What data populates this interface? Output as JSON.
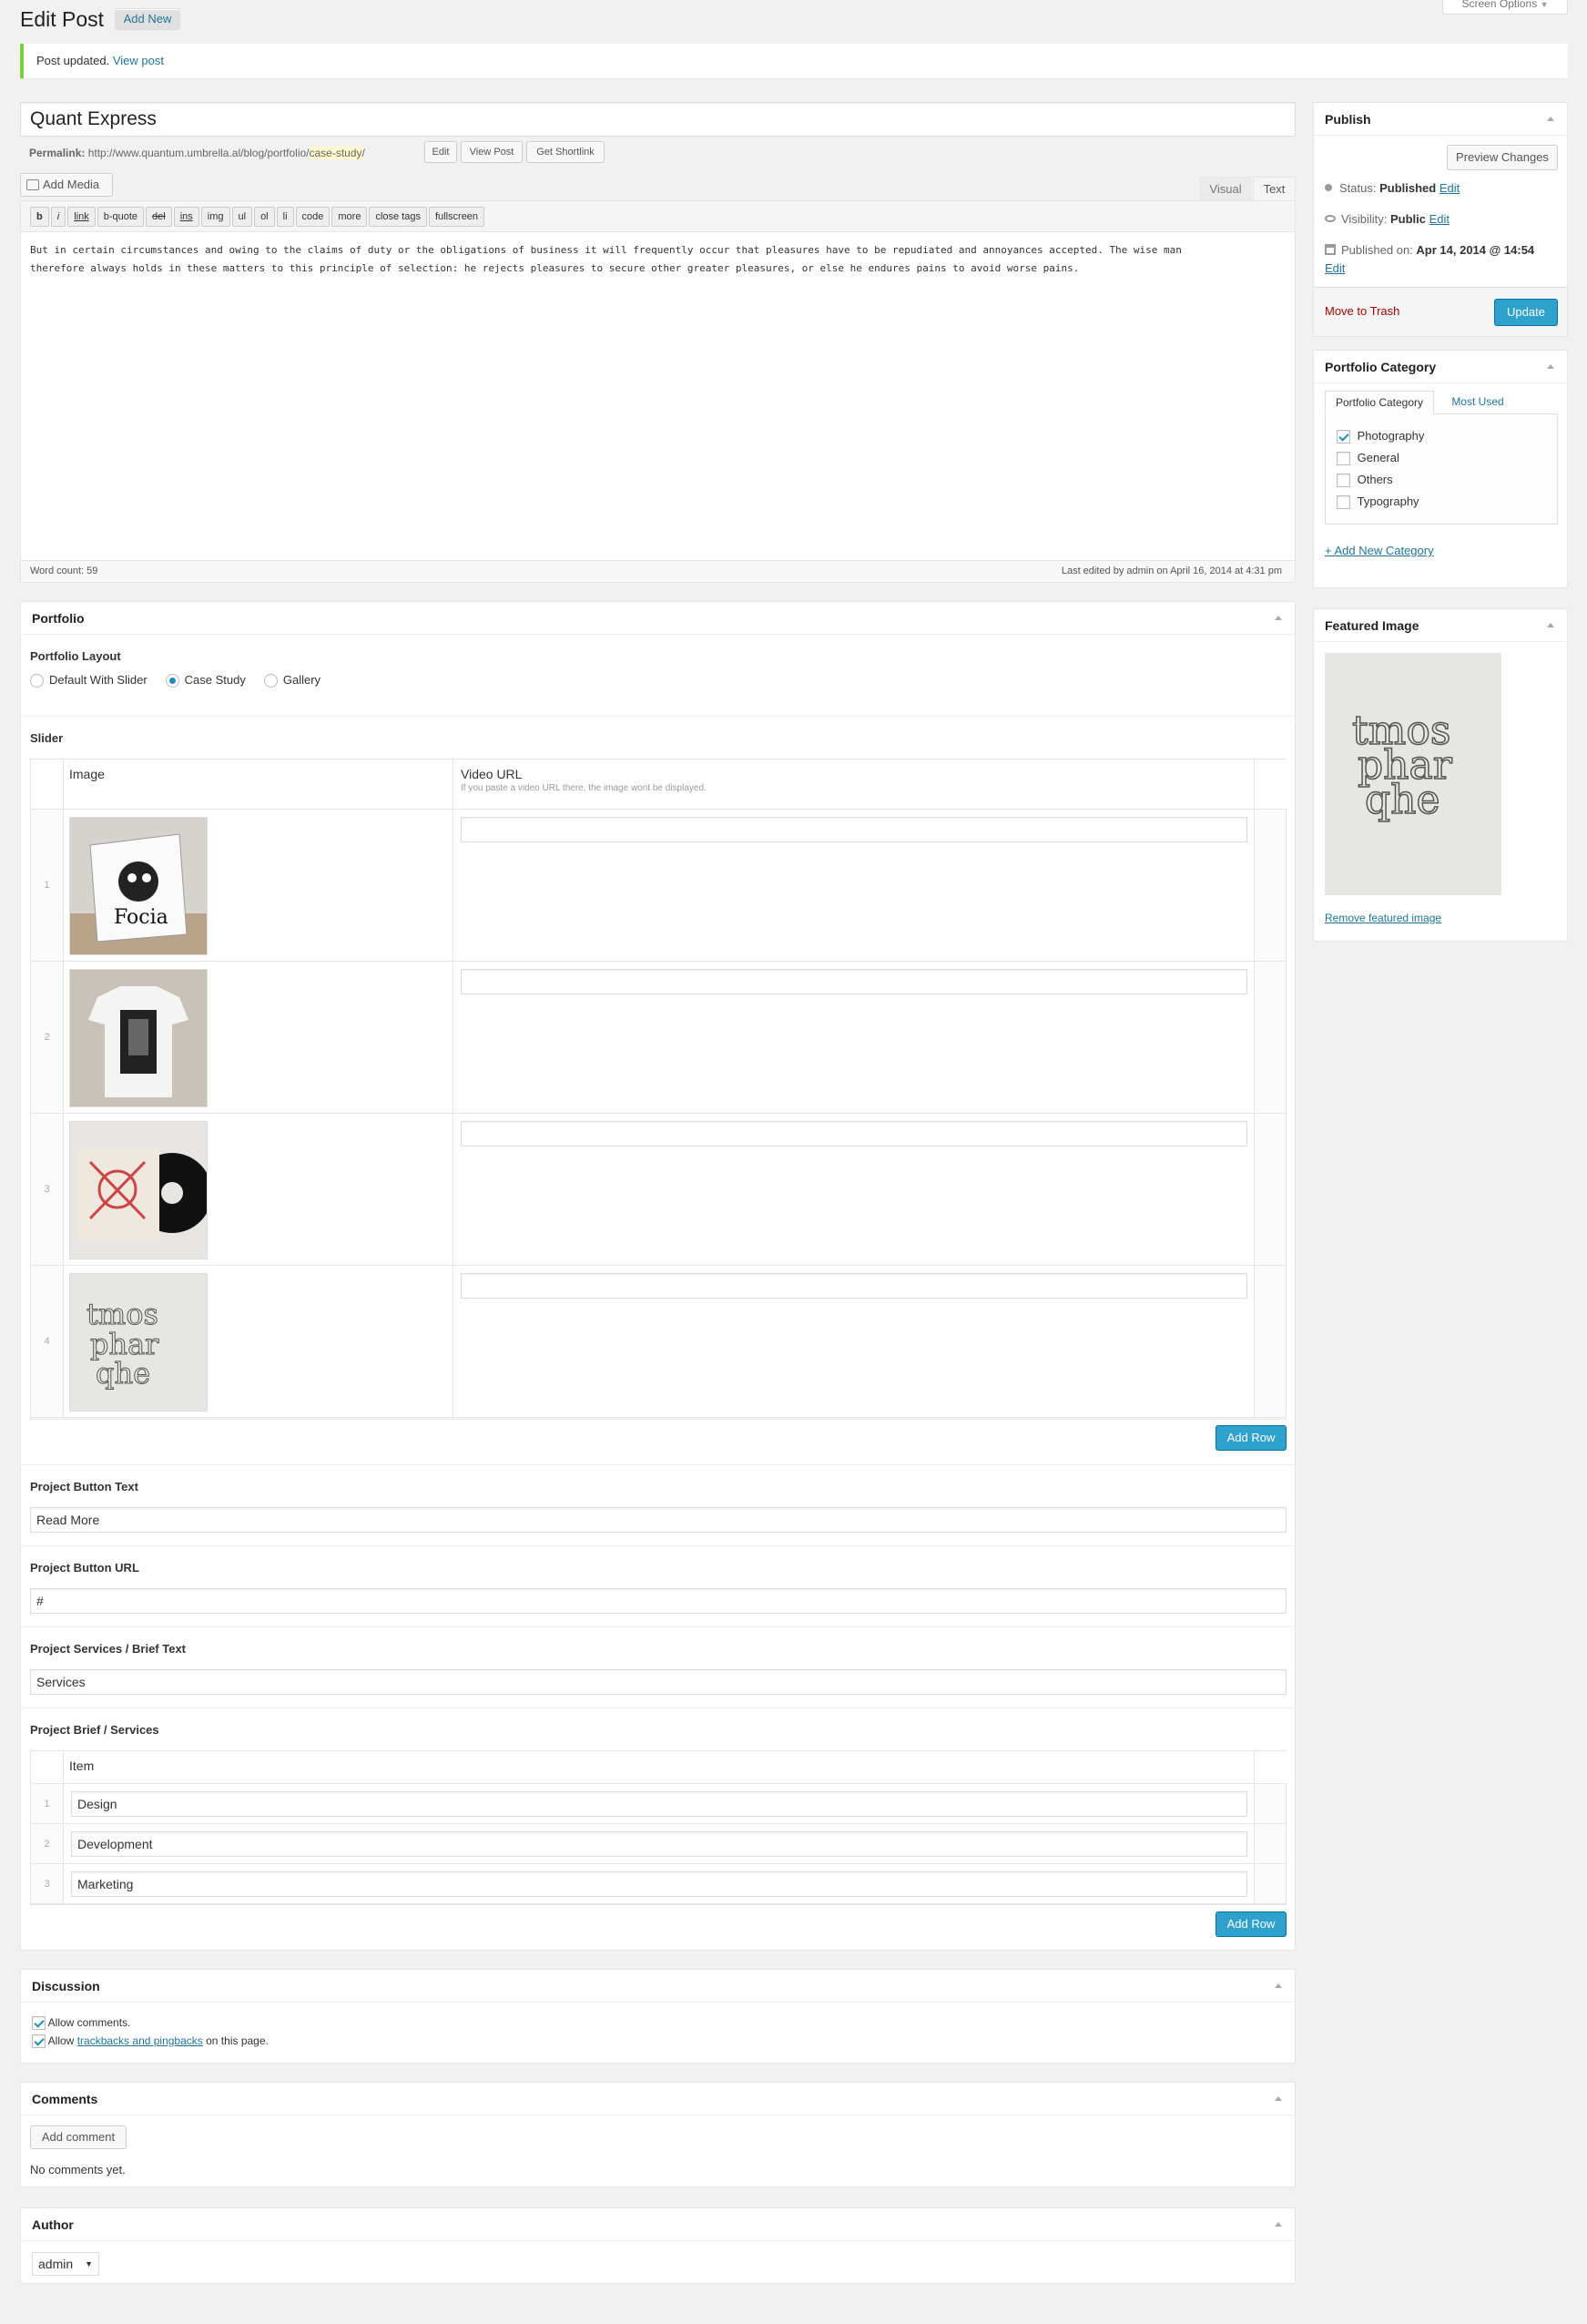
{
  "header": {
    "title": "Edit Post",
    "add_new": "Add New",
    "screen_options": "Screen Options"
  },
  "notice": {
    "text": "Post updated.",
    "link": "View post"
  },
  "post": {
    "title": "Quant Express",
    "permalink_label": "Permalink:",
    "permalink_base": "http://www.quantum.umbrella.al/blog/portfolio/",
    "permalink_slug": "case-study",
    "permalink_end": "/",
    "btn_edit": "Edit",
    "btn_view_post": "View Post",
    "btn_shortlink": "Get Shortlink"
  },
  "editor": {
    "add_media": "Add Media",
    "tab_visual": "Visual",
    "tab_text": "Text",
    "quicktags": [
      "b",
      "i",
      "link",
      "b-quote",
      "del",
      "ins",
      "img",
      "ul",
      "ol",
      "li",
      "code",
      "more",
      "close tags",
      "fullscreen"
    ],
    "content_line1": "But in certain circumstances and owing to the claims of duty or the obligations of business it will frequently occur that pleasures have to be repudiated and annoyances accepted. The wise man",
    "content_line2": "therefore always holds in these matters to this principle of selection: he rejects pleasures to secure other greater pleasures, or else he endures pains to avoid worse pains.",
    "word_count": "Word count: 59",
    "last_edited": "Last edited by admin on April 16, 2014 at 4:31 pm"
  },
  "portfolio": {
    "title": "Portfolio",
    "layout_label": "Portfolio Layout",
    "layout_options": [
      "Default With Slider",
      "Case Study",
      "Gallery"
    ],
    "layout_selected": "Case Study",
    "slider_label": "Slider",
    "col_image": "Image",
    "col_video": "Video URL",
    "col_video_hint": "If you paste a video URL there, the image wont be displayed.",
    "rows": [
      {
        "num": "1",
        "video": ""
      },
      {
        "num": "2",
        "video": ""
      },
      {
        "num": "3",
        "video": ""
      },
      {
        "num": "4",
        "video": ""
      }
    ],
    "add_row": "Add Row",
    "button_text_label": "Project Button Text",
    "button_text_value": "Read More",
    "button_url_label": "Project Button URL",
    "button_url_value": "#",
    "services_label": "Project Services / Brief Text",
    "services_value": "Services",
    "brief_label": "Project Brief / Services",
    "brief_col": "Item",
    "brief_items": [
      {
        "num": "1",
        "value": "Design"
      },
      {
        "num": "2",
        "value": "Development"
      },
      {
        "num": "3",
        "value": "Marketing"
      }
    ],
    "add_row_2": "Add Row"
  },
  "discussion": {
    "title": "Discussion",
    "allow_comments": "Allow comments.",
    "allow_pre": "Allow",
    "allow_link": "trackbacks and pingbacks",
    "allow_post": "on this page."
  },
  "comments": {
    "title": "Comments",
    "add_comment": "Add comment",
    "none": "No comments yet."
  },
  "author": {
    "title": "Author",
    "value": "admin"
  },
  "publish": {
    "title": "Publish",
    "preview": "Preview Changes",
    "status_label": "Status:",
    "status_value": "Published",
    "visibility_label": "Visibility:",
    "visibility_value": "Public",
    "published_label": "Published on:",
    "published_value": "Apr 14, 2014 @ 14:54",
    "edit": "Edit",
    "trash": "Move to Trash",
    "update": "Update"
  },
  "category": {
    "title": "Portfolio Category",
    "tab_all": "Portfolio Category",
    "tab_most": "Most Used",
    "items": [
      {
        "label": "Photography",
        "checked": true
      },
      {
        "label": "General",
        "checked": false
      },
      {
        "label": "Others",
        "checked": false
      },
      {
        "label": "Typography",
        "checked": false
      }
    ],
    "add_new": "+ Add New Category"
  },
  "featured": {
    "title": "Featured Image",
    "remove": "Remove featured image"
  },
  "colors": {
    "accent": "#2ea2cc",
    "link": "#21759b",
    "notice_border": "#7ad03a",
    "trash": "#a00"
  }
}
